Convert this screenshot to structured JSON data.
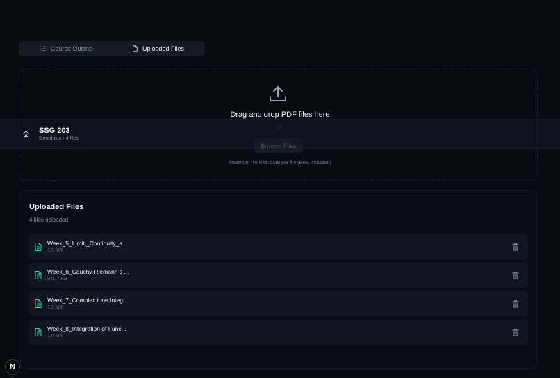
{
  "tabs": [
    {
      "label": "Course Outline",
      "icon": "list-icon",
      "active": false
    },
    {
      "label": "Uploaded Files",
      "icon": "file-icon",
      "active": true
    }
  ],
  "dropzone": {
    "title": "Drag and drop PDF files here",
    "or": "or",
    "browse_label": "Browse Files",
    "max_size": "Maximum file size: 5MB per file (Beta limitation)"
  },
  "course": {
    "title": "SSG 203",
    "meta": "5 modules • 4 files"
  },
  "files": {
    "title": "Uploaded Files",
    "count": "4 files uploaded",
    "items": [
      {
        "name": "Week_5_Limit,_Continuity_a...",
        "size": "1.5 MB"
      },
      {
        "name": "Week_6_Cauchy-Riemann s ...",
        "size": "941.7 KB"
      },
      {
        "name": "Week_7_Complex Line Integ...",
        "size": "1.2 MB"
      },
      {
        "name": "Week_8_Integration of Func...",
        "size": "1.0 MB"
      }
    ]
  },
  "badge": {
    "letter": "N"
  },
  "colors": {
    "background": "#080b12",
    "accent_green": "#34d399",
    "muted": "#8b93a1"
  }
}
